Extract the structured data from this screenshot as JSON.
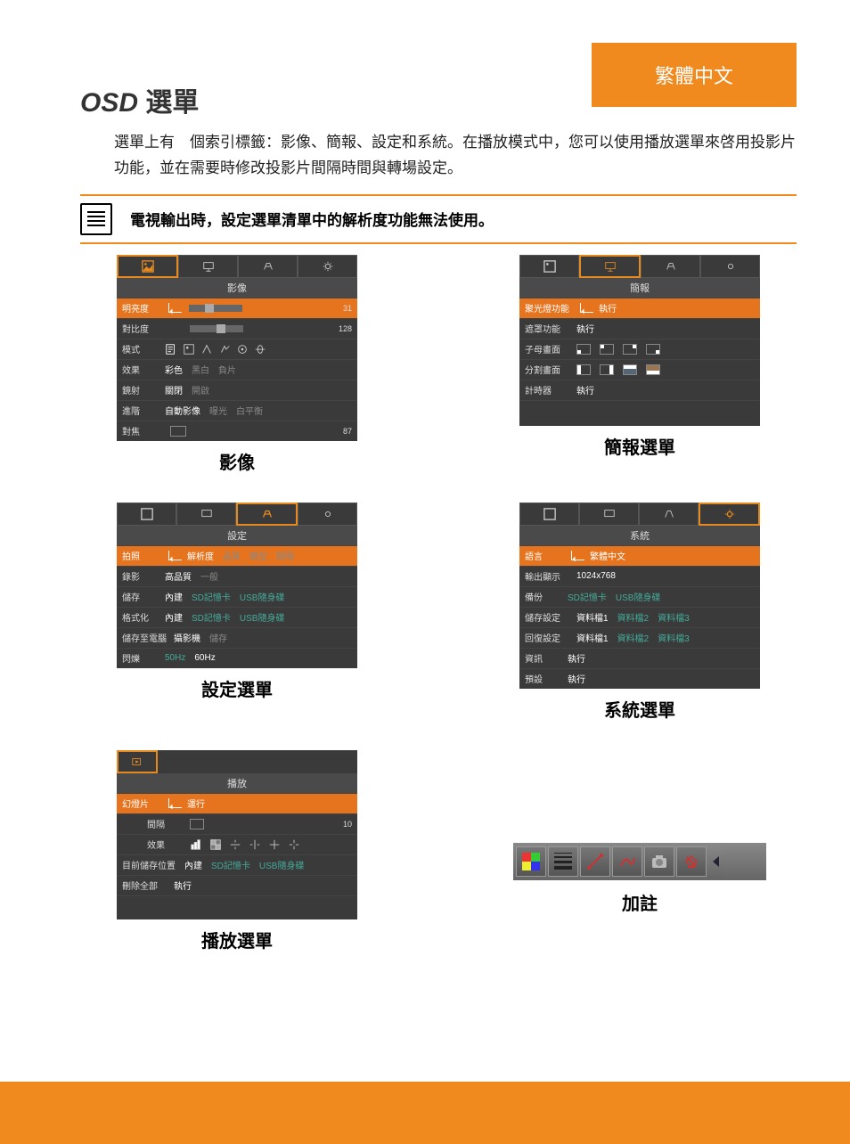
{
  "header": {
    "language_label": "繁體中文",
    "title_prefix": "OSD",
    "title_suffix": " 選單",
    "intro": "選單上有　個索引標籤：影像、簡報、設定和系統。在播放模式中，您可以使用播放選單來啓用投影片功能，並在需要時修改投影片間隔時間與轉場設定。",
    "note": "電視輸出時，設定選單清單中的解析度功能無法使用。"
  },
  "captions": {
    "image": "影像",
    "presentation": "簡報選單",
    "setting": "設定選單",
    "system": "系統選單",
    "playback": "播放選單",
    "annotation": "加註"
  },
  "image_menu": {
    "title": "影像",
    "brightness": {
      "label": "明亮度",
      "value": "31"
    },
    "contrast": {
      "label": "對比度",
      "value": "128"
    },
    "mode": {
      "label": "模式"
    },
    "effect": {
      "label": "效果",
      "opts": [
        "彩色",
        "黑白",
        "負片"
      ]
    },
    "mirror": {
      "label": "鏡射",
      "opts": [
        "關閉",
        "開啟"
      ]
    },
    "advanced": {
      "label": "進階",
      "opts": [
        "自動影像",
        "曝光",
        "白平衡"
      ]
    },
    "focus": {
      "label": "對焦",
      "value": "87"
    }
  },
  "presentation_menu": {
    "title": "簡報",
    "spotlight": {
      "label": "聚光燈功能",
      "opt": "執行"
    },
    "mask": {
      "label": "遮罩功能",
      "opt": "執行"
    },
    "pip": {
      "label": "子母畫面"
    },
    "split": {
      "label": "分割畫面"
    },
    "timer": {
      "label": "計時器",
      "opt": "執行"
    }
  },
  "setting_menu": {
    "title": "設定",
    "capture": {
      "label": "拍照",
      "opts": [
        "解析度",
        "品質",
        "類型",
        "間隔"
      ]
    },
    "record": {
      "label": "錄影",
      "opts": [
        "高品質",
        "一般"
      ]
    },
    "storage": {
      "label": "儲存",
      "opts": [
        "內建",
        "SD記憶卡",
        "USB隨身碟"
      ]
    },
    "format": {
      "label": "格式化",
      "opts": [
        "內建",
        "SD記憶卡",
        "USB隨身碟"
      ]
    },
    "usb": {
      "label": "儲存至電腦",
      "opts": [
        "攝影機",
        "儲存"
      ]
    },
    "flicker": {
      "label": "閃爍",
      "opts": [
        "50Hz",
        "60Hz"
      ]
    }
  },
  "system_menu": {
    "title": "系統",
    "language": {
      "label": "語言",
      "value": "繁體中文"
    },
    "output": {
      "label": "輸出顯示",
      "value": "1024x768"
    },
    "backup": {
      "label": "備份",
      "opts": [
        "SD記憶卡",
        "USB隨身碟"
      ]
    },
    "save_set": {
      "label": "儲存設定",
      "opts": [
        "資料檔1",
        "資料檔2",
        "資料檔3"
      ]
    },
    "recall_set": {
      "label": "回復設定",
      "opts": [
        "資料檔1",
        "資料檔2",
        "資料檔3"
      ]
    },
    "info": {
      "label": "資訊",
      "opt": "執行"
    },
    "default": {
      "label": "預設",
      "opt": "執行"
    }
  },
  "playback_menu": {
    "title": "播放",
    "slideshow": {
      "label": "幻燈片",
      "opt": "運行"
    },
    "interval": {
      "label": "間隔",
      "value": "10"
    },
    "effect": {
      "label": "效果"
    },
    "location": {
      "label": "目前儲存位置",
      "opts": [
        "內建",
        "SD記憶卡",
        "USB隨身碟"
      ]
    },
    "delete_all": {
      "label": "刪除全部",
      "opt": "執行"
    }
  }
}
